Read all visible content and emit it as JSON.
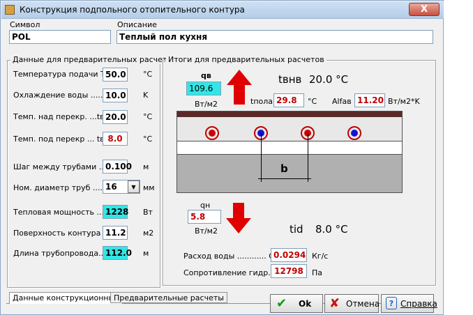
{
  "window": {
    "title": "Конструкция подпольного отопительного контура",
    "close_label": "X"
  },
  "symbol": {
    "label": "Символ",
    "value": "POL"
  },
  "description": {
    "label": "Описание",
    "value": "Теплый пол кухня"
  },
  "left_panel": {
    "title": "Данные для предварительных расчетов",
    "rows": [
      {
        "label": "Температура подачи  Тп",
        "value": "50.0",
        "unit": "°C"
      },
      {
        "label": "Охлаждение воды ..... dT",
        "value": "10.0",
        "unit": "K"
      },
      {
        "label": "Темп. над перекр. ...tвнв",
        "value": "20.0",
        "unit": "°C"
      },
      {
        "label": "Темп. под перекр ... tвнн",
        "value": "8.0",
        "unit": "°C"
      },
      {
        "label": "Шаг между трубами ... b",
        "value": "0.100",
        "unit": "м"
      },
      {
        "label": "Ном. диаметр труб .... dn",
        "value": "16",
        "unit": "мм"
      },
      {
        "label": "Тепловая мощность .....",
        "value": "1228",
        "unit": "Вт"
      },
      {
        "label": "Поверхность контура",
        "value": "11.2",
        "unit": "м2"
      },
      {
        "label": "Длина трубопровода... L",
        "value": "112.0",
        "unit": "м"
      }
    ]
  },
  "right_panel": {
    "title": "Итоги для предварительных расчетов",
    "qv": {
      "label": "qв",
      "value": "109.6",
      "unit": "Вт/м2"
    },
    "tvnv": {
      "label": "tвнв",
      "value": "20.0 °C"
    },
    "tpola": {
      "label": "tпола",
      "value": "29.8",
      "unit": "°C"
    },
    "alfav": {
      "label": "Alfaв",
      "value": "11.20",
      "unit": "Вт/м2*K"
    },
    "spacing_label": "b",
    "qn": {
      "label": "qн",
      "value": "5.8",
      "unit": "Вт/м2"
    },
    "tid": {
      "label": "tid",
      "value": "8.0 °C"
    },
    "flow": {
      "label": "Расход воды ............ G",
      "value": "0.0294",
      "unit": "Кг/с"
    },
    "resistance": {
      "label": "Сопротивление гидр. dP",
      "value": "12798",
      "unit": "Па"
    }
  },
  "tabs": [
    "Данные конструкционные",
    "Предварительные расчеты"
  ],
  "buttons": {
    "ok": "Ok",
    "cancel": "Отмена",
    "help": "Справка"
  },
  "colors": {
    "hot_pipe": "#d00000",
    "cold_pipe": "#1414d0",
    "highlight": "#33e6e6",
    "arrow": "#e00000"
  }
}
